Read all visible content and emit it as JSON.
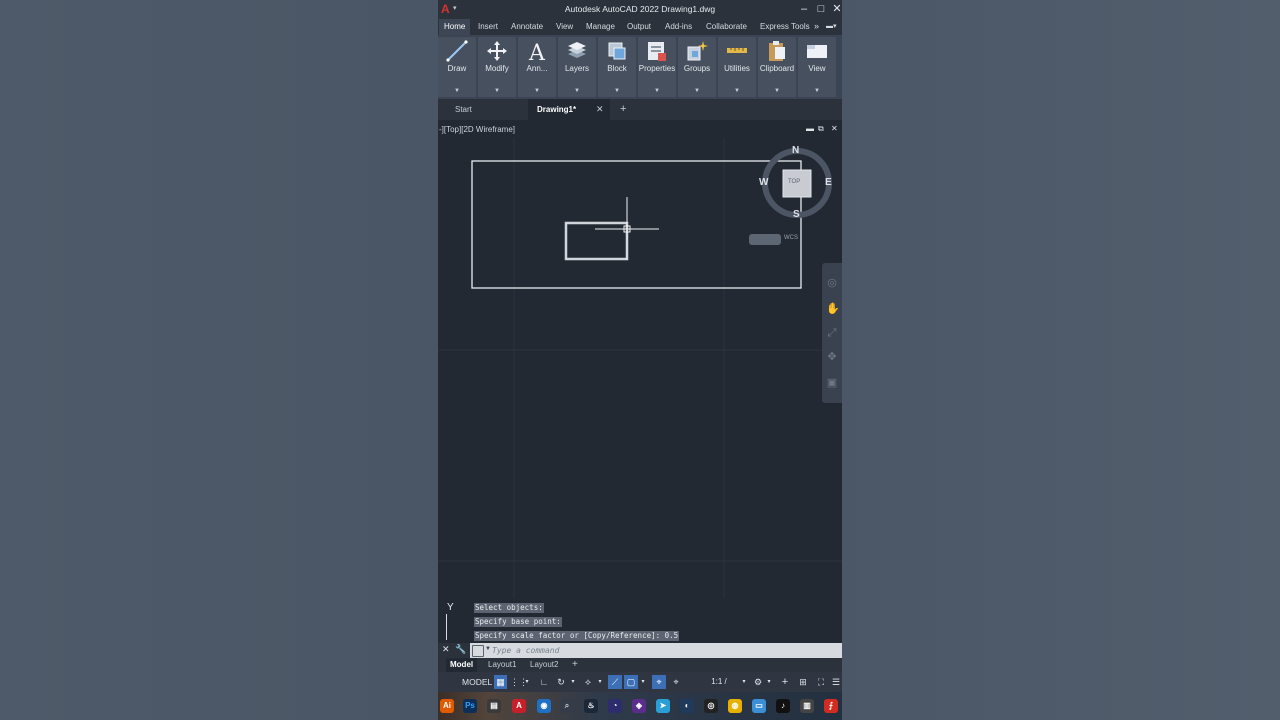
{
  "window": {
    "title": "Autodesk AutoCAD 2022   Drawing1.dwg",
    "logo_letter": "A",
    "minimize": "–",
    "maximize": "□",
    "close": "✕"
  },
  "ribbon_tabs": [
    "Home",
    "Insert",
    "Annotate",
    "View",
    "Manage",
    "Output",
    "Add-ins",
    "Collaborate",
    "Express Tools"
  ],
  "ribbon_panels": [
    {
      "label": "Draw",
      "icon": "line-icon"
    },
    {
      "label": "Modify",
      "icon": "move-icon"
    },
    {
      "label": "Ann...",
      "icon": "text-icon"
    },
    {
      "label": "Layers",
      "icon": "layers-icon"
    },
    {
      "label": "Block",
      "icon": "block-icon"
    },
    {
      "label": "Properties",
      "icon": "properties-icon"
    },
    {
      "label": "Groups",
      "icon": "groups-icon"
    },
    {
      "label": "Utilities",
      "icon": "measure-icon"
    },
    {
      "label": "Clipboard",
      "icon": "clipboard-icon"
    },
    {
      "label": "View",
      "icon": "view-icon"
    }
  ],
  "doc_tabs": {
    "start": "Start",
    "active": "Drawing1*",
    "close": "✕",
    "add": "+"
  },
  "viewport": {
    "label": "-][Top][2D Wireframe]",
    "restore": "⧉",
    "close": "✕"
  },
  "viewcube": {
    "north": "N",
    "south": "S",
    "east": "E",
    "west": "W",
    "face": "TOP",
    "ucs": "WCS"
  },
  "command_history": [
    "Select objects:",
    "Specify base point:",
    "Specify scale factor or [Copy/Reference]: 0.5"
  ],
  "command_input": {
    "placeholder": "Type a command"
  },
  "layout_tabs": [
    "Model",
    "Layout1",
    "Layout2"
  ],
  "status_bar": {
    "model": "MODEL",
    "scale": "1:1 / 100%"
  },
  "colors": {
    "canvas": "#222933",
    "accent": "#3c6fb5",
    "panel": "#46505f"
  }
}
